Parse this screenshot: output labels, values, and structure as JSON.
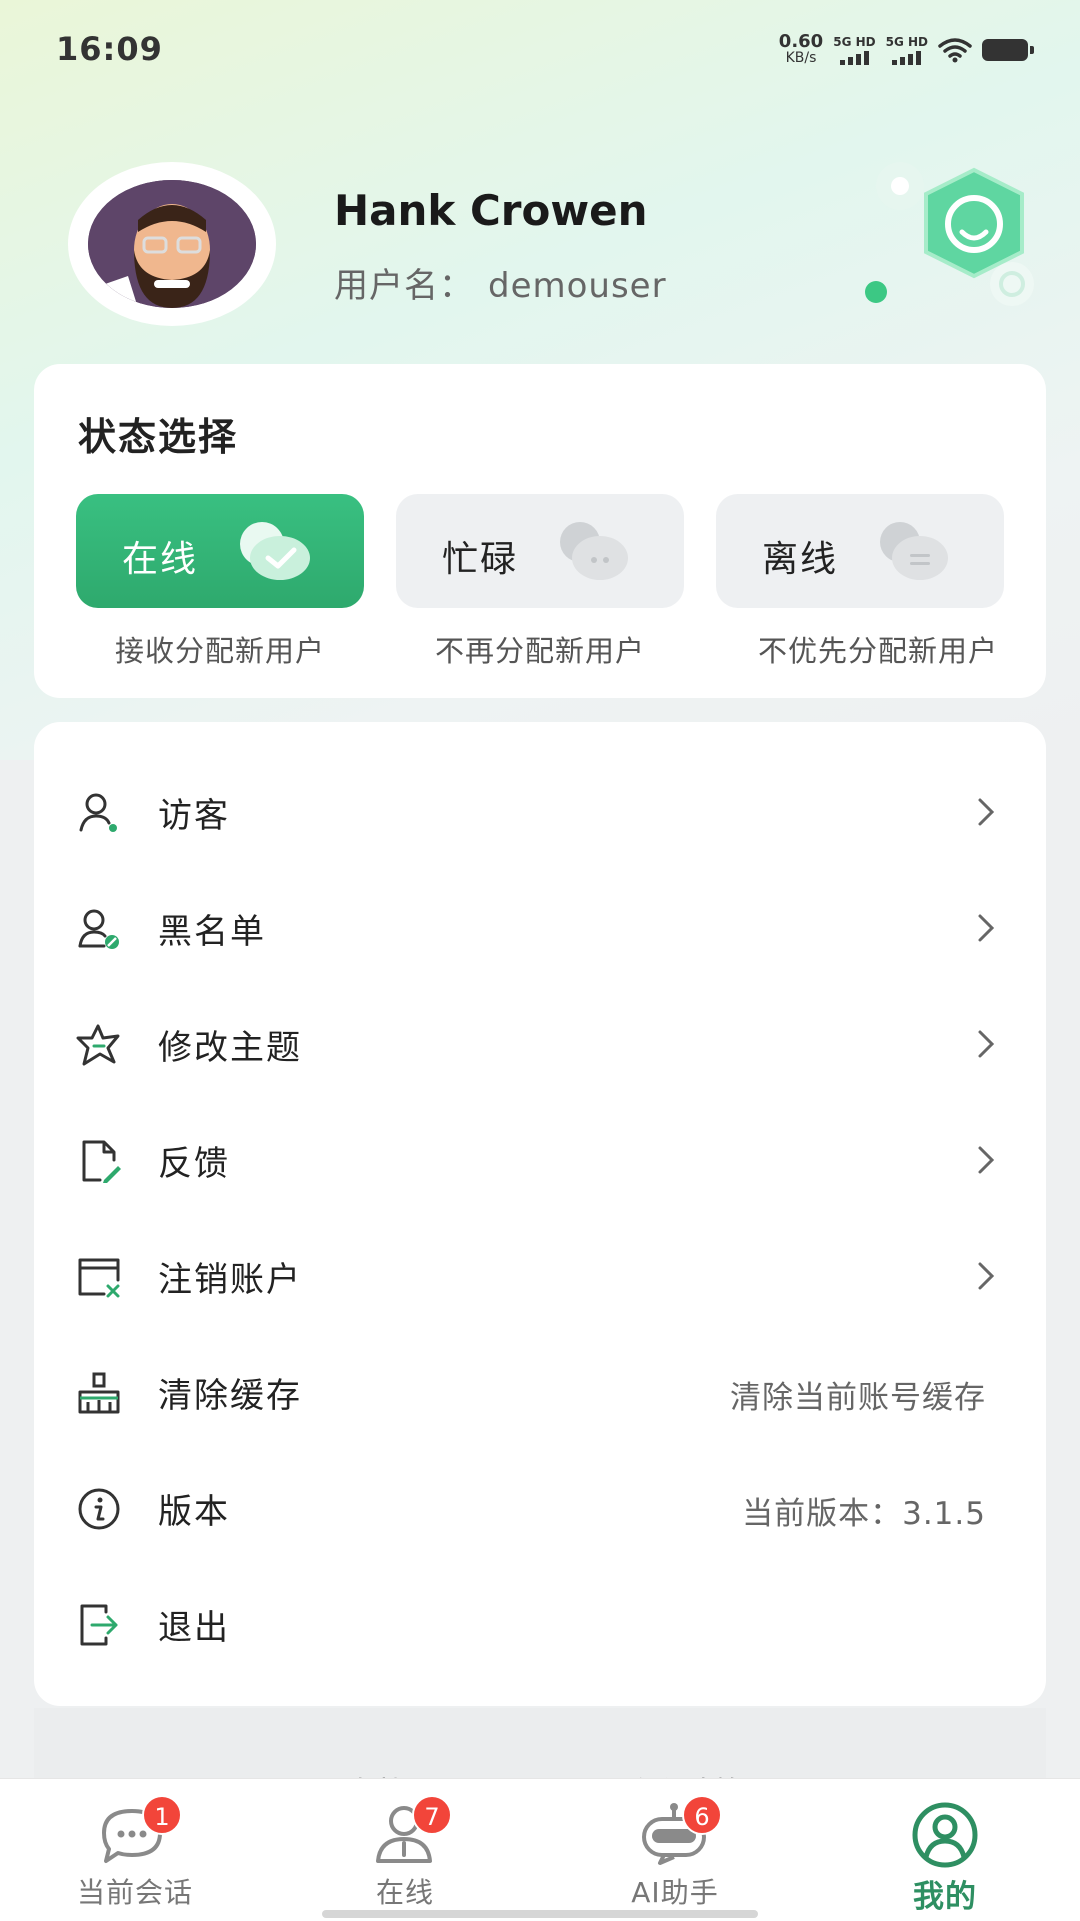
{
  "status_bar": {
    "time": "16:09",
    "net_speed_value": "0.60",
    "net_speed_unit": "KB/s",
    "sim1": "5G HD",
    "sim2": "5G HD"
  },
  "profile": {
    "display_name": "Hank Crowen",
    "username_label": "用户名：",
    "username": "demouser"
  },
  "status_section": {
    "title": "状态选择",
    "options": [
      {
        "label": "在线",
        "desc": "接收分配新用户",
        "active": true
      },
      {
        "label": "忙碌",
        "desc": "不再分配新用户",
        "active": false
      },
      {
        "label": "离线",
        "desc": "不优先分配新用户",
        "active": false
      }
    ]
  },
  "menu": {
    "items": [
      {
        "label": "访客",
        "icon": "visitor-icon"
      },
      {
        "label": "黑名单",
        "icon": "blacklist-icon"
      },
      {
        "label": "修改主题",
        "icon": "theme-icon"
      },
      {
        "label": "反馈",
        "icon": "feedback-icon"
      },
      {
        "label": "注销账户",
        "icon": "delete-account-icon"
      },
      {
        "label": "清除缓存",
        "icon": "clear-cache-icon",
        "value": "清除当前账号缓存"
      },
      {
        "label": "版本",
        "icon": "info-icon",
        "value": "当前版本：3.1.5"
      },
      {
        "label": "退出",
        "icon": "logout-icon"
      }
    ]
  },
  "footer_links": {
    "service_agreement": "服务协议",
    "privacy_policy": "隐私政策"
  },
  "tabbar": {
    "tabs": [
      {
        "label": "当前会话",
        "badge": "1",
        "icon": "chat-icon"
      },
      {
        "label": "在线",
        "badge": "7",
        "icon": "online-users-icon"
      },
      {
        "label": "AI助手",
        "badge": "6",
        "icon": "ai-assistant-icon"
      },
      {
        "label": "我的",
        "icon": "profile-icon",
        "active": true
      }
    ]
  },
  "colors": {
    "accent": "#2ea96d",
    "accent_dark": "#2e8f62",
    "badge": "#f2453a"
  }
}
